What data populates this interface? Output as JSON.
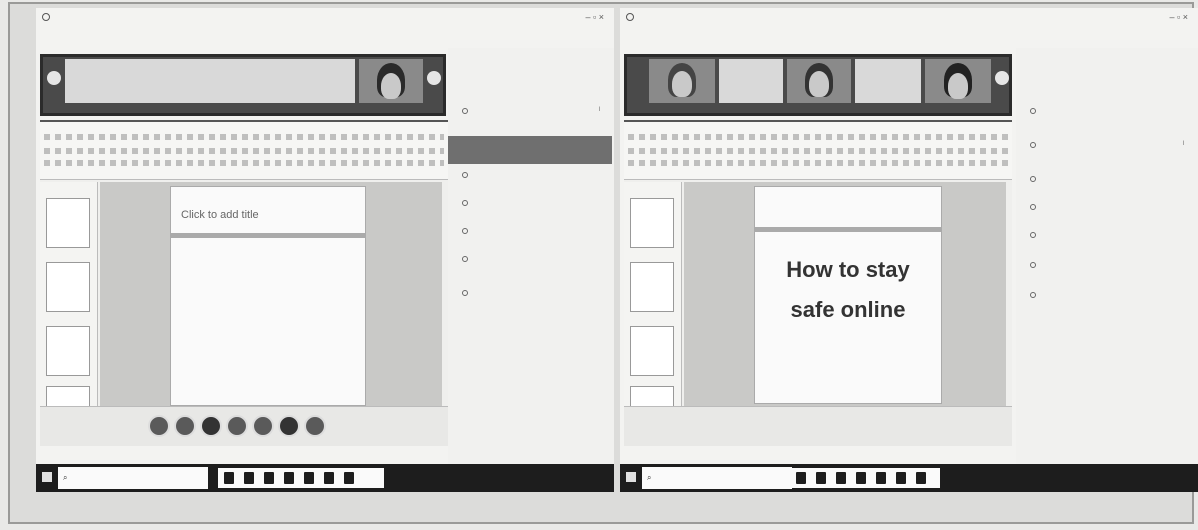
{
  "left_screen": {
    "slide": {
      "title_placeholder": "Click to add title"
    }
  },
  "right_screen": {
    "slide": {
      "title_line1": "How to stay",
      "title_line2": "safe online"
    }
  },
  "icons": [
    "windows-start-icon",
    "search-icon",
    "microphone-icon",
    "video-icon"
  ]
}
